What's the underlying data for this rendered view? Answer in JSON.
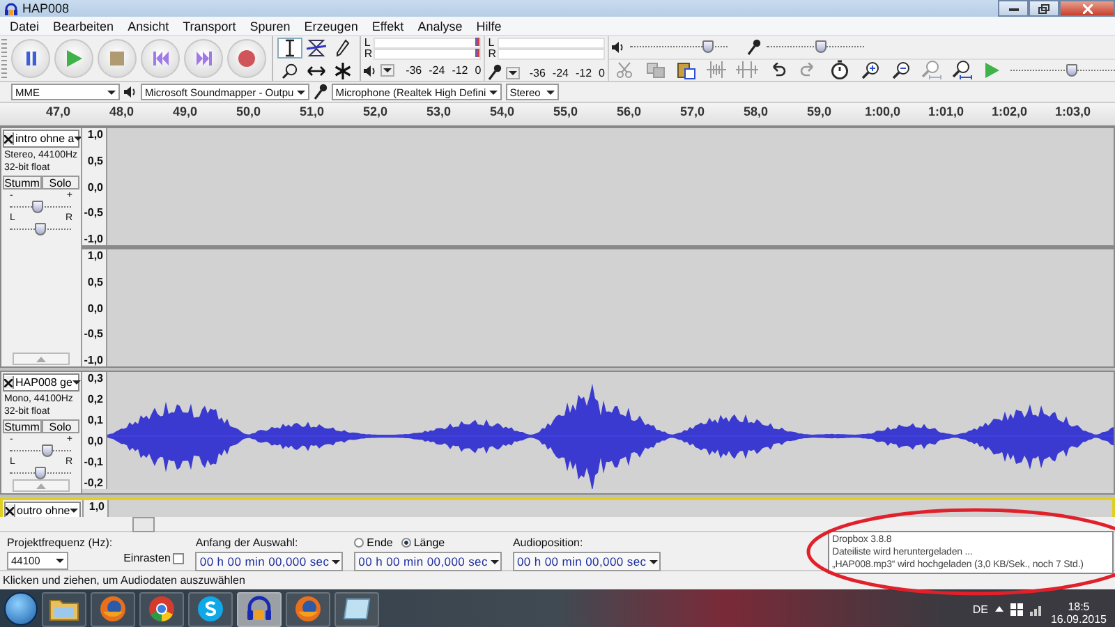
{
  "window": {
    "title": "HAP008"
  },
  "menu": [
    "Datei",
    "Bearbeiten",
    "Ansicht",
    "Transport",
    "Spuren",
    "Erzeugen",
    "Effekt",
    "Analyse",
    "Hilfe"
  ],
  "transport": [
    {
      "kind": "pause"
    },
    {
      "kind": "play"
    },
    {
      "kind": "stop"
    },
    {
      "kind": "skip_start"
    },
    {
      "kind": "skip_end"
    },
    {
      "kind": "record"
    }
  ],
  "tools": [
    {
      "kind": "select",
      "selected": true
    },
    {
      "kind": "envelope",
      "selected": false
    },
    {
      "kind": "draw",
      "selected": false
    },
    {
      "kind": "zoom",
      "selected": false
    },
    {
      "kind": "timeshift",
      "selected": false
    },
    {
      "kind": "multi",
      "selected": false
    }
  ],
  "meters": [
    {
      "kind": "playback",
      "channels": [
        "L",
        "R"
      ],
      "scale": [
        "-36",
        "-24",
        "-12",
        "0"
      ]
    },
    {
      "kind": "record",
      "channels": [
        "L",
        "R"
      ],
      "scale": [
        "-36",
        "-24",
        "-12",
        "0"
      ]
    }
  ],
  "mixer": {
    "playback": {
      "level": 0.8
    },
    "record": {
      "level": 0.55
    }
  },
  "edit_tools": [
    {
      "kind": "cut",
      "disabled": true
    },
    {
      "kind": "copy",
      "disabled": true
    },
    {
      "kind": "paste",
      "disabled": false
    },
    {
      "kind": "trim",
      "disabled": true
    },
    {
      "kind": "silence",
      "disabled": true
    },
    {
      "kind": "undo",
      "disabled": false
    },
    {
      "kind": "redo",
      "disabled": true
    },
    {
      "kind": "sync",
      "disabled": false
    },
    {
      "kind": "zoom_in",
      "disabled": false
    },
    {
      "kind": "zoom_out",
      "disabled": false
    },
    {
      "kind": "fit_selection",
      "disabled": true
    },
    {
      "kind": "fit_project",
      "disabled": false
    }
  ],
  "play_at_speed": {
    "level": 0.58
  },
  "devices": {
    "host": "MME",
    "output": "Microsoft Soundmapper - Outpu",
    "input": "Microphone (Realtek High Defini",
    "channels": "Stereo"
  },
  "timeline": [
    "47,0",
    "48,0",
    "49,0",
    "50,0",
    "51,0",
    "52,0",
    "53,0",
    "54,0",
    "55,0",
    "56,0",
    "57,0",
    "58,0",
    "59,0",
    "1:00,0",
    "1:01,0",
    "1:02,0",
    "1:03,0"
  ],
  "tracks": [
    {
      "name": "intro ohne a",
      "selected": false,
      "info": [
        "Stereo, 44100Hz",
        "32-bit float"
      ],
      "mute": "Stumm",
      "solo": "Solo",
      "gain_labels": [
        "-",
        "+"
      ],
      "gain": {
        "level": 0.45
      },
      "pan_labels": [
        "L",
        "R"
      ],
      "pan": {
        "level": 0.5
      },
      "channels": [
        {
          "scale": [
            "1,0",
            "0,5",
            "0,0",
            "-0,5",
            "-1,0"
          ],
          "waveform": false
        },
        {
          "scale": [
            "1,0",
            "0,5",
            "0,0",
            "-0,5",
            "-1,0"
          ],
          "waveform": false
        }
      ]
    },
    {
      "name": "HAP008 ge",
      "selected": false,
      "info": [
        "Mono, 44100Hz",
        "32-bit float"
      ],
      "mute": "Stumm",
      "solo": "Solo",
      "gain_labels": [
        "-",
        "+"
      ],
      "gain": {
        "level": 0.62
      },
      "pan_labels": [
        "L",
        "R"
      ],
      "pan": {
        "level": 0.5
      },
      "channels": [
        {
          "scale": [
            "0,3",
            "0,2",
            "0,1",
            "0,0",
            "-0,1",
            "-0,2"
          ],
          "waveform": true
        }
      ]
    },
    {
      "name": "outro ohne",
      "selected": true,
      "channels": [
        {
          "scale": [
            "1,0"
          ],
          "waveform": false
        }
      ]
    }
  ],
  "selection_bar": {
    "rate_label": "Projektfrequenz (Hz):",
    "rate": "44100",
    "snap": {
      "label": "Einrasten",
      "checked": false
    },
    "start_label": "Anfang der Auswahl:",
    "start": "00 h 00 min 00,000 sec",
    "modes": [
      {
        "label": "Ende",
        "selected": false
      },
      {
        "label": "Länge",
        "selected": true
      }
    ],
    "length": "00 h 00 min 00,000 sec",
    "position_label": "Audioposition:",
    "position": "00 h 00 min 00,000 sec"
  },
  "status_bar": "Klicken und ziehen, um Audiodaten auszuwählen",
  "taskbar": {
    "apps": [
      {
        "kind": "folder",
        "selected": false
      },
      {
        "kind": "firefox",
        "selected": false
      },
      {
        "kind": "chrome",
        "selected": false
      },
      {
        "kind": "skype",
        "selected": false
      },
      {
        "kind": "audacity",
        "selected": true
      },
      {
        "kind": "firefox",
        "selected": false
      },
      {
        "kind": "notes",
        "selected": false
      }
    ],
    "language": "DE",
    "time": "18:5",
    "date": "16.09.2015"
  },
  "notification": {
    "lines": [
      "Dropbox 3.8.8",
      "Dateiliste wird heruntergeladen ...",
      "„HAP008.mp3“ wird hochgeladen (3,0 KB/Sek., noch 7 Std.)"
    ]
  }
}
